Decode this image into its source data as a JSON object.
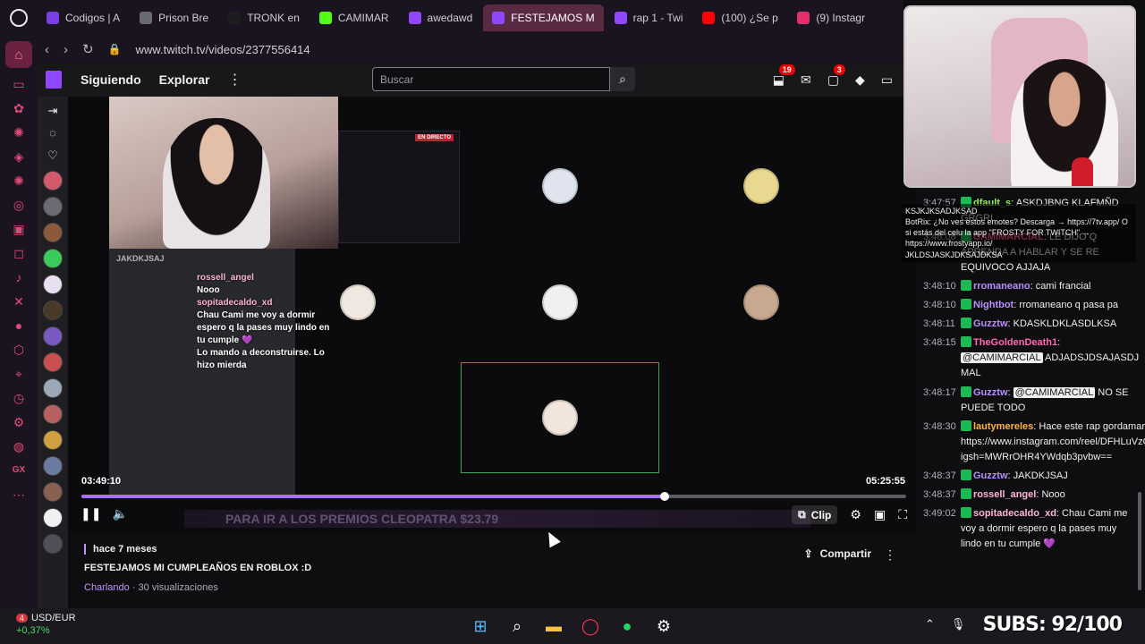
{
  "browser": {
    "tabs": [
      {
        "label": "Codigos | A",
        "color": "#7b3fe4"
      },
      {
        "label": "Prison Bre",
        "color": "#6a6a74"
      },
      {
        "label": "TRONK en",
        "color": "#1d1d1f"
      },
      {
        "label": "CAMIMAR",
        "color": "#53fc18"
      },
      {
        "label": "awedawd",
        "color": "#9146ff"
      },
      {
        "label": "FESTEJAMOS M",
        "color": "#9146ff",
        "active": true
      },
      {
        "label": "rap 1 - Twi",
        "color": "#9146ff"
      },
      {
        "label": "(100) ¿Se p",
        "color": "#ff0000"
      },
      {
        "label": "(9) Instagr",
        "color": "#e1306c"
      }
    ],
    "url": "www.twitch.tv/videos/2377556414"
  },
  "twitch_nav": {
    "following": "Siguiendo",
    "explore": "Explorar",
    "search_placeholder": "Buscar",
    "notifications_count": "19",
    "whispers_count": "3"
  },
  "video": {
    "discord": {
      "name_1": "rossell_angel",
      "msg_1": "Nooo",
      "name_2": "sopitadecaldo_xd",
      "msg_2": "Chau Cami me voy a dormir espero q la pases muy lindo en tu cumple 💜",
      "msg_3": "Lo mando a deconstruirse. Lo hizo mierda",
      "header": "JAKDKJSAJ",
      "live_badge": "EN DIRECTO"
    },
    "time_current": "03:49:10",
    "time_total": "05:25:55",
    "progress_fraction": 0.707,
    "ticker_text": "PARA IR A LOS PREMIOS CLEOPATRA $23.79",
    "clip_label": "Clip",
    "tiles": [
      {
        "bg": "#b8b8cc"
      },
      {
        "bg": "#d7d8a8"
      },
      {
        "bg": "#8aa872"
      },
      {
        "bg": "#2e2e2e"
      },
      {
        "bg": "#3a3028"
      },
      {
        "bg": "#e0b49c"
      }
    ]
  },
  "info": {
    "posted_ago": "hace 7 meses",
    "title": "FESTEJAMOS MI CUMPLEAÑOS EN ROBLOX :D",
    "category": "Charlando",
    "views": " · 30 visualizaciones",
    "share_label": "Compartir"
  },
  "chat_float": {
    "line1": "KSJKJKSADJKSAD",
    "line2": "BotRix: ¿No ves estos emotes? Descarga → https://7tv.app/ O si estás del celu la app \"FROSTY FOR TWITCH\" → https://www.frostyapp.io/",
    "line3": "JKLDSJASKJDKSAJDKSA"
  },
  "chat": [
    {
      "ts": "3:47:57",
      "user": "dfault_s",
      "color": "#9aee59",
      "text": ": ASKDJBNG KLAFMÑD GRGRI"
    },
    {
      "ts": "3:48:08",
      "user": "CAMIMARCIAL",
      "color": "#ff5c8a",
      "text": ": LE DIJO Q APRENDA A HABLAR Y SE RE EQUIVOCO AJJAJA"
    },
    {
      "ts": "3:48:10",
      "user": "rromaneano",
      "color": "#b88fff",
      "text": ": cami francial"
    },
    {
      "ts": "3:48:10",
      "user": "Nightbot",
      "color": "#b88fff",
      "text": ": rromaneano q pasa pa"
    },
    {
      "ts": "3:48:11",
      "user": "Guzztw",
      "color": "#b88fff",
      "text": ": KDASKLDKLASDLKSA"
    },
    {
      "ts": "3:48:15",
      "user": "TheGoldenDeath1",
      "color": "#ff69b4",
      "mention": "@CAMIMARCIAL",
      "text": " ADJADSJDSAJASDJ MAL"
    },
    {
      "ts": "3:48:17",
      "user": "Guzztw",
      "color": "#b88fff",
      "mention": "@CAMIMARCIAL",
      "text": " NO SE PUEDE TODO"
    },
    {
      "ts": "3:48:30",
      "user": "lautymereles",
      "color": "#ffb347",
      "text": ": Hace este rap gordamarcial https://www.instagram.com/reel/DFHLuVzOIXI/?igsh=MWRrOHR4YWdqb3pvbw=="
    },
    {
      "ts": "3:48:37",
      "user": "Guzztw",
      "color": "#b88fff",
      "text": ": JAKDKJSAJ"
    },
    {
      "ts": "3:48:37",
      "user": "rossell_angel",
      "color": "#ffb6d9",
      "text": ": Nooo"
    },
    {
      "ts": "3:49:02",
      "user": "sopitadecaldo_xd",
      "color": "#ffb6d9",
      "text": ": Chau Cami me voy a dormir espero q la pases muy lindo en tu cumple 💜"
    }
  ],
  "taskbar": {
    "fx_pair": "USD/EUR",
    "fx_change": "+0,37%",
    "fx_badge": "4",
    "subs": "SUBS: 92/100"
  }
}
